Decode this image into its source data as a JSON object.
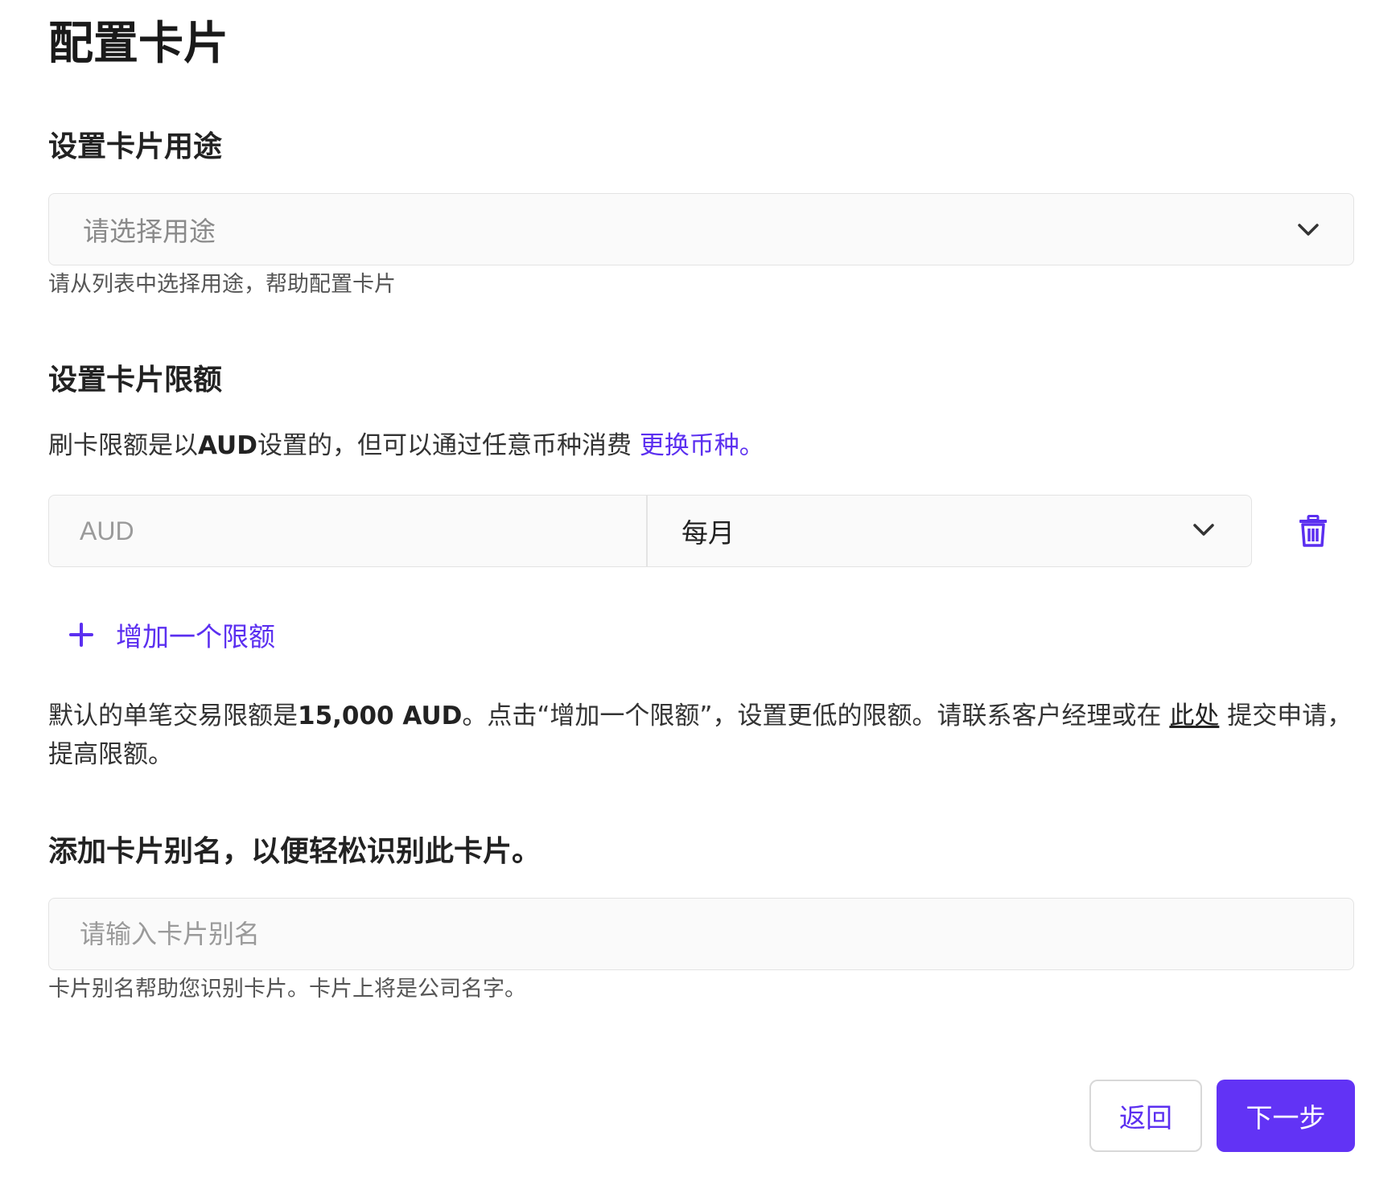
{
  "page": {
    "title": "配置卡片"
  },
  "purpose": {
    "heading": "设置卡片用途",
    "select_placeholder": "请选择用途",
    "helper": "请从列表中选择用途，帮助配置卡片"
  },
  "limits": {
    "heading": "设置卡片限额",
    "desc_prefix": "刷卡限额是以",
    "desc_currency": "AUD",
    "desc_suffix": "设置的，但可以通过任意币种消费 ",
    "change_currency_link": "更换币种。",
    "amount_placeholder": "AUD",
    "period_value": "每月",
    "add_limit_label": "增加一个限额",
    "default_prefix": "默认的单笔交易限额是",
    "default_amount": "15,000 AUD",
    "default_middle": "。点击“增加一个限额”，设置更低的限额。请联系客户经理或在 ",
    "here_link": "此处",
    "default_suffix": " 提交申请，提高限额。"
  },
  "alias": {
    "heading": "添加卡片别名，以便轻松识别此卡片。",
    "input_placeholder": "请输入卡片别名",
    "helper": "卡片别名帮助您识别卡片。卡片上将是公司名字。"
  },
  "footer": {
    "back_label": "返回",
    "next_label": "下一步"
  },
  "colors": {
    "accent": "#6233f5",
    "link": "#5b2ff0"
  },
  "icons": {
    "dropdown": "chevron-down-icon",
    "delete": "trash-icon",
    "add": "plus-icon"
  }
}
